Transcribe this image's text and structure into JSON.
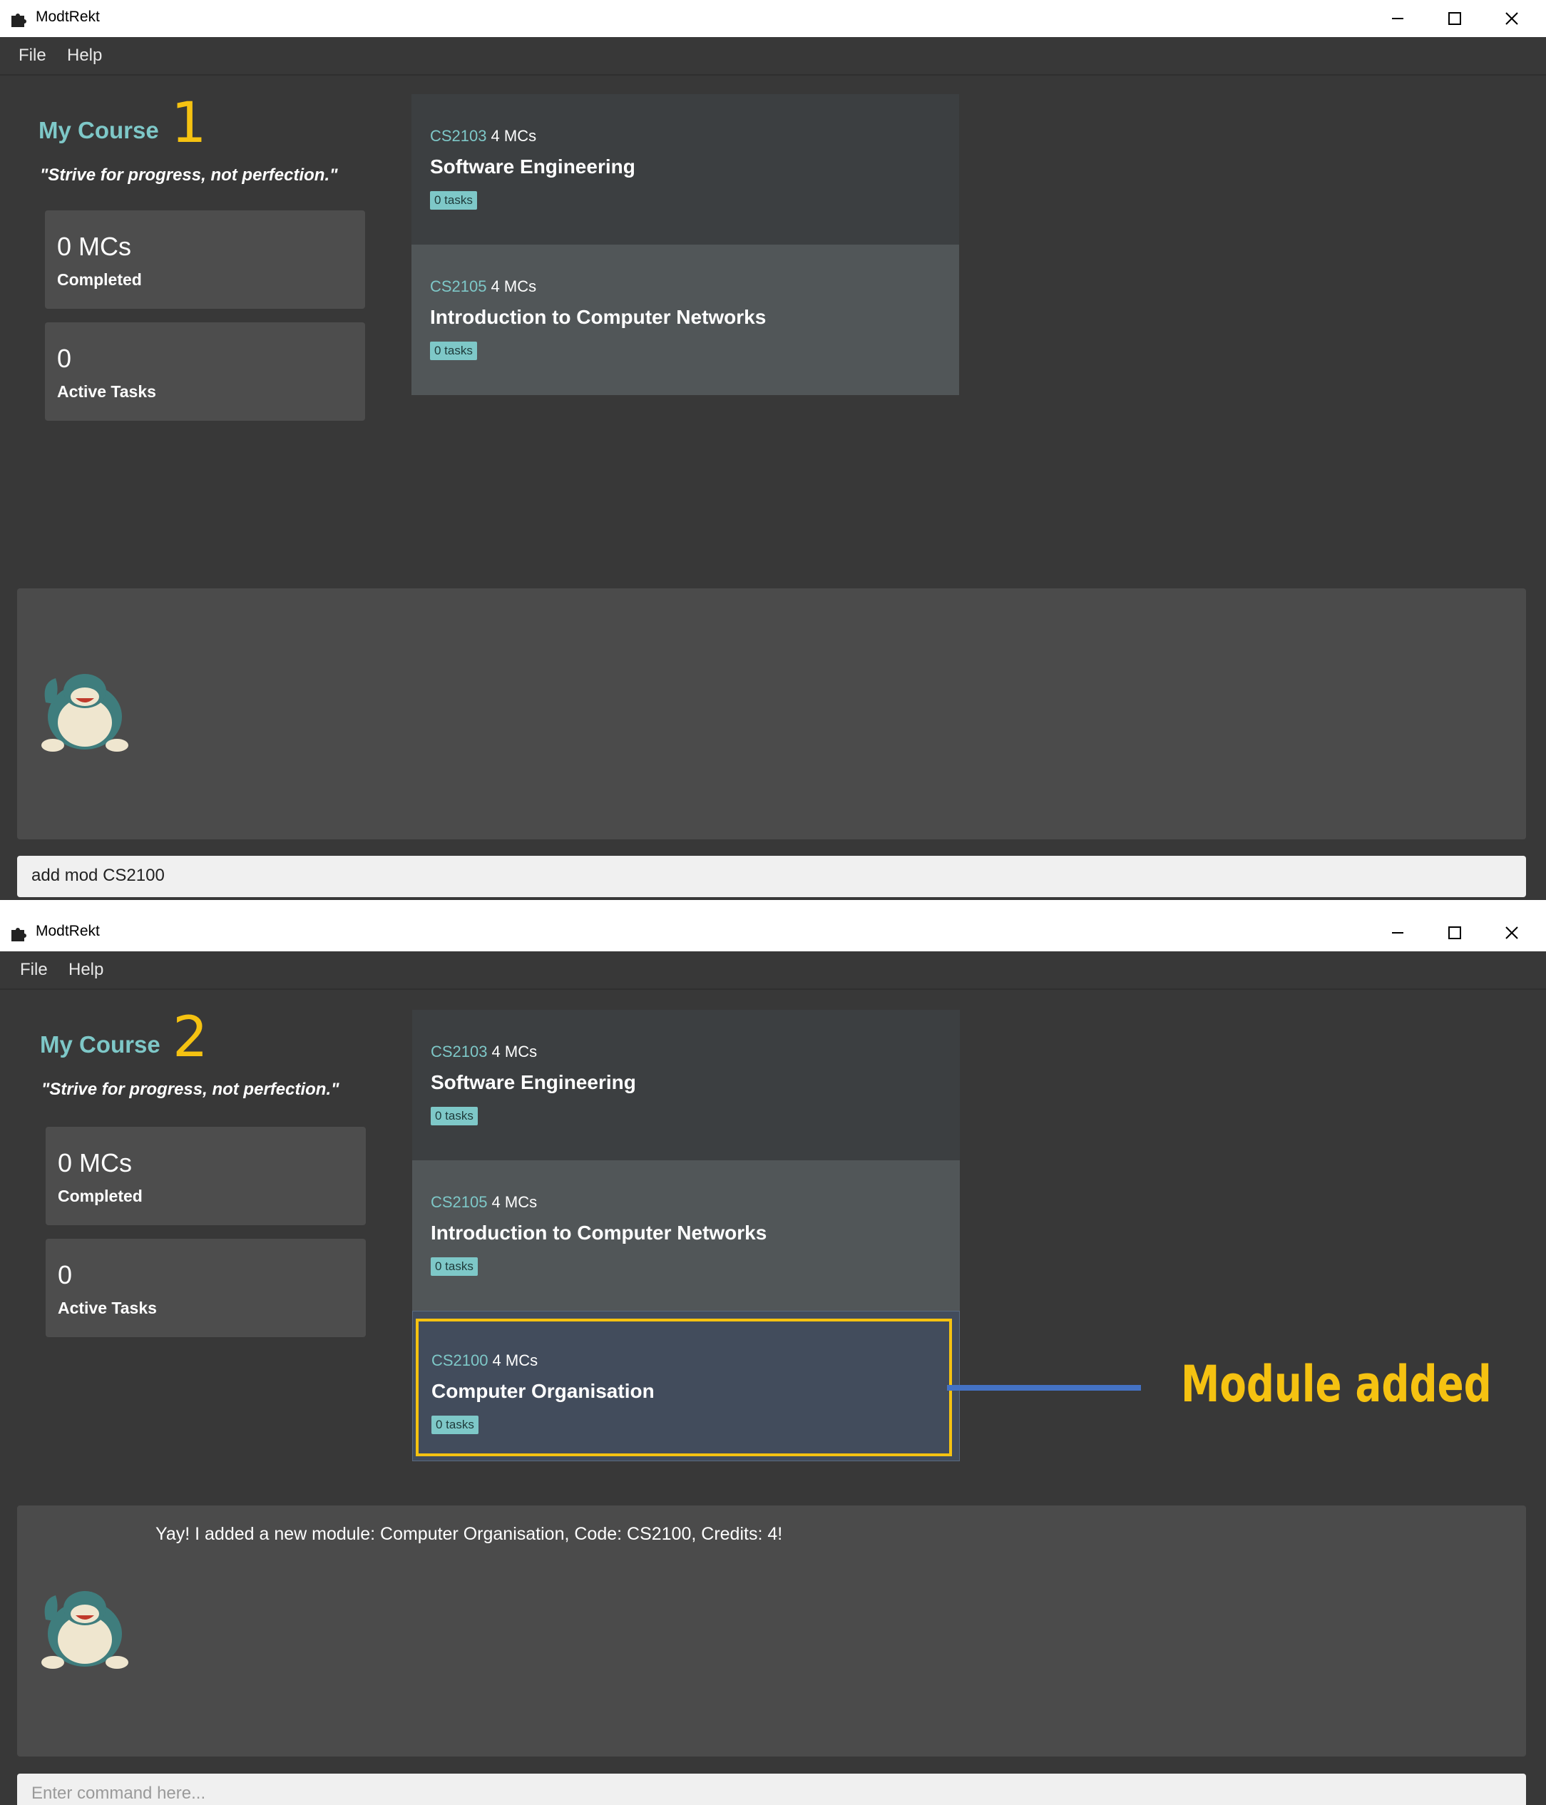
{
  "windows": [
    {
      "app_title": "ModtRekt",
      "menu": [
        "File",
        "Help"
      ],
      "course_title": "My Course",
      "step_number": "1",
      "quote": "\"Strive for progress, not perfection.\"",
      "stats": {
        "mcs_value": "0 MCs",
        "mcs_label": "Completed",
        "tasks_value": "0",
        "tasks_label": "Active Tasks"
      },
      "modules": [
        {
          "code": "CS2103",
          "mcs": "4 MCs",
          "name": "Software Engineering",
          "tasks": "0 tasks"
        },
        {
          "code": "CS2105",
          "mcs": "4 MCs",
          "name": "Introduction to Computer Networks",
          "tasks": "0 tasks"
        }
      ],
      "result_text": "",
      "command_value": "add mod CS2100",
      "command_placeholder": ""
    },
    {
      "app_title": "ModtRekt",
      "menu": [
        "File",
        "Help"
      ],
      "course_title": "My Course",
      "step_number": "2",
      "quote": "\"Strive for progress, not perfection.\"",
      "stats": {
        "mcs_value": "0 MCs",
        "mcs_label": "Completed",
        "tasks_value": "0",
        "tasks_label": "Active Tasks"
      },
      "modules": [
        {
          "code": "CS2103",
          "mcs": "4 MCs",
          "name": "Software Engineering",
          "tasks": "0 tasks"
        },
        {
          "code": "CS2105",
          "mcs": "4 MCs",
          "name": "Introduction to Computer Networks",
          "tasks": "0 tasks"
        },
        {
          "code": "CS2100",
          "mcs": "4 MCs",
          "name": "Computer Organisation",
          "tasks": "0 tasks"
        }
      ],
      "result_text": "Yay! I added a new module: Computer Organisation, Code: CS2100, Credits: 4!",
      "command_value": "",
      "command_placeholder": "Enter command here..."
    }
  ],
  "annotation": {
    "label": "Module added",
    "color": "#f5c211",
    "connector_color": "#4472c4"
  },
  "colors": {
    "window_bg": "#383838",
    "card_bg_1": "#3c3f41",
    "card_bg_2": "#515658",
    "card_bg_selected": "#424c5c",
    "accent": "#7ec8c8"
  },
  "icons": {
    "app": "puzzle-piece-icon",
    "minimize": "minimize-icon",
    "maximize": "maximize-icon",
    "close": "close-icon",
    "mascot": "snorlax-mascot-icon"
  }
}
